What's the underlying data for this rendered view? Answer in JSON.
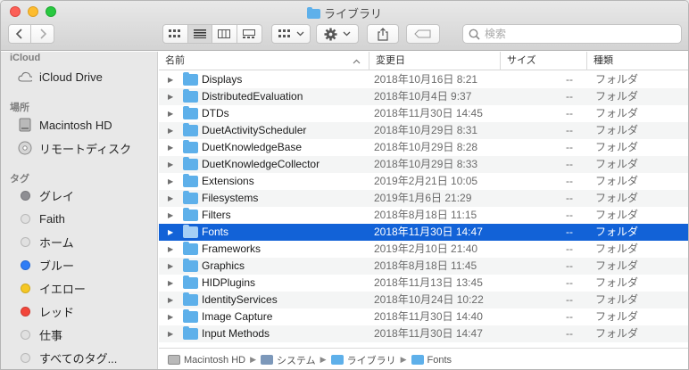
{
  "window": {
    "title": "ライブラリ"
  },
  "toolbar": {
    "back_icon": "chevron-left-icon",
    "forward_icon": "chevron-right-icon",
    "views": [
      "icon-view",
      "list-view",
      "column-view",
      "gallery-view"
    ],
    "share_icon": "share-icon",
    "tag_icon": "tag-icon"
  },
  "search": {
    "placeholder": "検索"
  },
  "sidebar": {
    "section_icloud": "iCloud",
    "icloud_drive": "iCloud Drive",
    "section_places": "場所",
    "places": [
      "Macintosh HD",
      "リモートディスク"
    ],
    "section_tags": "タグ",
    "tags": [
      {
        "label": "グレイ",
        "color": "#8e8e93"
      },
      {
        "label": "Faith",
        "color": "#e0e0e0"
      },
      {
        "label": "ホーム",
        "color": "#e0e0e0"
      },
      {
        "label": "ブルー",
        "color": "#2f7df6"
      },
      {
        "label": "イエロー",
        "color": "#f5c724"
      },
      {
        "label": "レッド",
        "color": "#f2463b"
      },
      {
        "label": "仕事",
        "color": "#e0e0e0"
      },
      {
        "label": "すべてのタグ...",
        "color": "#e0e0e0"
      }
    ]
  },
  "columns": {
    "name": "名前",
    "date": "変更日",
    "size": "サイズ",
    "kind": "種類"
  },
  "rows": [
    {
      "name": "Displays",
      "date": "2018年10月16日 8:21",
      "size": "--",
      "kind": "フォルダ"
    },
    {
      "name": "DistributedEvaluation",
      "date": "2018年10月4日 9:37",
      "size": "--",
      "kind": "フォルダ"
    },
    {
      "name": "DTDs",
      "date": "2018年11月30日 14:45",
      "size": "--",
      "kind": "フォルダ"
    },
    {
      "name": "DuetActivityScheduler",
      "date": "2018年10月29日 8:31",
      "size": "--",
      "kind": "フォルダ"
    },
    {
      "name": "DuetKnowledgeBase",
      "date": "2018年10月29日 8:28",
      "size": "--",
      "kind": "フォルダ"
    },
    {
      "name": "DuetKnowledgeCollector",
      "date": "2018年10月29日 8:33",
      "size": "--",
      "kind": "フォルダ"
    },
    {
      "name": "Extensions",
      "date": "2019年2月21日 10:05",
      "size": "--",
      "kind": "フォルダ"
    },
    {
      "name": "Filesystems",
      "date": "2019年1月6日 21:29",
      "size": "--",
      "kind": "フォルダ"
    },
    {
      "name": "Filters",
      "date": "2018年8月18日 11:15",
      "size": "--",
      "kind": "フォルダ"
    },
    {
      "name": "Fonts",
      "date": "2018年11月30日 14:47",
      "size": "--",
      "kind": "フォルダ",
      "selected": true
    },
    {
      "name": "Frameworks",
      "date": "2019年2月10日 21:40",
      "size": "--",
      "kind": "フォルダ"
    },
    {
      "name": "Graphics",
      "date": "2018年8月18日 11:45",
      "size": "--",
      "kind": "フォルダ"
    },
    {
      "name": "HIDPlugins",
      "date": "2018年11月13日 13:45",
      "size": "--",
      "kind": "フォルダ"
    },
    {
      "name": "IdentityServices",
      "date": "2018年10月24日 10:22",
      "size": "--",
      "kind": "フォルダ"
    },
    {
      "name": "Image Capture",
      "date": "2018年11月30日 14:40",
      "size": "--",
      "kind": "フォルダ"
    },
    {
      "name": "Input Methods",
      "date": "2018年11月30日 14:47",
      "size": "--",
      "kind": "フォルダ"
    }
  ],
  "pathbar": [
    "Macintosh HD",
    "システム",
    "ライブラリ",
    "Fonts"
  ],
  "colors": {
    "selection": "#1262d7",
    "folder": "#5eb0ea"
  }
}
